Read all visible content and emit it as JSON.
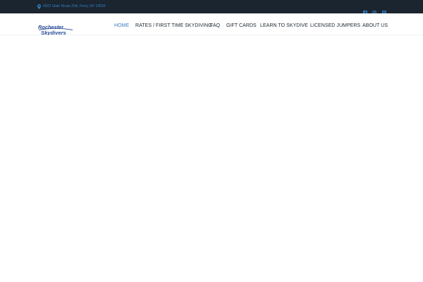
{
  "topbar": {
    "address": "6522 State Route 20A, Perry, NY 14530",
    "social": [
      {
        "icon": "facebook-icon"
      },
      {
        "icon": "instagram-icon"
      },
      {
        "icon": "tripadvisor-icon"
      }
    ]
  },
  "logo": {
    "line1": "Rochester",
    "line2": "Skydivers"
  },
  "nav": {
    "items": [
      {
        "label": "HOME",
        "active": true
      },
      {
        "label": "RATES / FIRST TIME SKYDIVING",
        "active": false
      },
      {
        "label": "FAQ",
        "active": false
      },
      {
        "label": "GIFT CARDS",
        "active": false
      },
      {
        "label": "LEARN TO SKYDIVE",
        "active": false
      },
      {
        "label": "LICENSED JUMPERS",
        "active": false
      },
      {
        "label": "ABOUT US",
        "active": false
      }
    ]
  },
  "colors": {
    "topbar_bg": "#1b2530",
    "accent": "#3d7bc4",
    "nav_text": "#222b33",
    "logo": "#2a4c9a"
  }
}
